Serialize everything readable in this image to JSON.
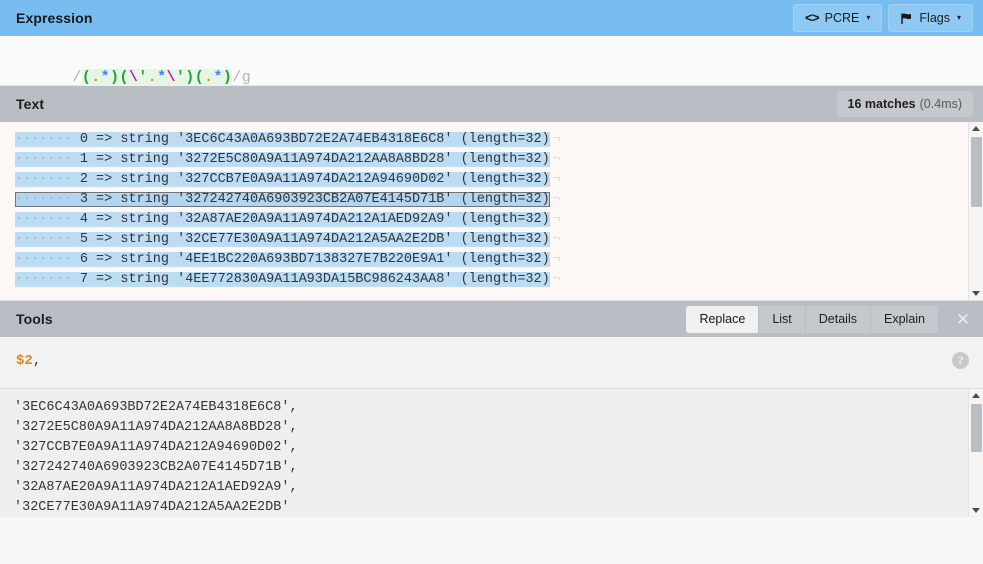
{
  "expression": {
    "panel_title": "Expression",
    "engine_button": {
      "label": "PCRE",
      "icon": "code-icon",
      "caret": "▾"
    },
    "flags_button": {
      "label": "Flags",
      "icon": "flag-icon",
      "caret": "▾"
    },
    "delimiter": "/",
    "flags": "g",
    "pattern": "(.*)(\\'.*\\')(.*)",
    "tokens": [
      {
        "t": "(",
        "k": "paren",
        "g": 1
      },
      {
        "t": ".",
        "k": "dot",
        "g": 1
      },
      {
        "t": "*",
        "k": "star",
        "g": 1
      },
      {
        "t": ")",
        "k": "paren",
        "g": 1
      },
      {
        "t": "(",
        "k": "paren",
        "g": 2
      },
      {
        "t": "\\",
        "k": "esc",
        "g": 2
      },
      {
        "t": "'",
        "k": "quote",
        "g": 2
      },
      {
        "t": ".",
        "k": "dot",
        "g": 2
      },
      {
        "t": "*",
        "k": "star",
        "g": 2
      },
      {
        "t": "\\",
        "k": "esc",
        "g": 2
      },
      {
        "t": "'",
        "k": "quote",
        "g": 2
      },
      {
        "t": ")",
        "k": "paren",
        "g": 2
      },
      {
        "t": "(",
        "k": "paren",
        "g": 3
      },
      {
        "t": ".",
        "k": "dot",
        "g": 3
      },
      {
        "t": "*",
        "k": "star",
        "g": 3
      },
      {
        "t": ")",
        "k": "paren",
        "g": 3
      }
    ]
  },
  "text": {
    "panel_title": "Text",
    "match_count_label": "16 matches",
    "match_time": "(0.4ms)",
    "indent": "·······",
    "eol_marker": "¬",
    "lines": [
      {
        "index": "0",
        "arrow": "=>",
        "type": "string",
        "value": "'3EC6C43A0A693BD72E2A74EB4318E6C8'",
        "length": "(length=32)",
        "selected": false
      },
      {
        "index": "1",
        "arrow": "=>",
        "type": "string",
        "value": "'3272E5C80A9A11A974DA212AA8A8BD28'",
        "length": "(length=32)",
        "selected": false
      },
      {
        "index": "2",
        "arrow": "=>",
        "type": "string",
        "value": "'327CCB7E0A9A11A974DA212A94690D02'",
        "length": "(length=32)",
        "selected": false
      },
      {
        "index": "3",
        "arrow": "=>",
        "type": "string",
        "value": "'327242740A6903923CB2A07E4145D71B'",
        "length": "(length=32)",
        "selected": true
      },
      {
        "index": "4",
        "arrow": "=>",
        "type": "string",
        "value": "'32A87AE20A9A11A974DA212A1AED92A9'",
        "length": "(length=32)",
        "selected": false
      },
      {
        "index": "5",
        "arrow": "=>",
        "type": "string",
        "value": "'32CE77E30A9A11A974DA212A5AA2E2DB'",
        "length": "(length=32)",
        "selected": false
      },
      {
        "index": "6",
        "arrow": "=>",
        "type": "string",
        "value": "'4EE1BC220A693BD7138327E7B220E9A1'",
        "length": "(length=32)",
        "selected": false
      },
      {
        "index": "7",
        "arrow": "=>",
        "type": "string",
        "value": "'4EE772830A9A11A93DA15BC986243AA8'",
        "length": "(length=32)",
        "selected": false
      }
    ]
  },
  "tools": {
    "panel_title": "Tools",
    "tabs": [
      {
        "label": "Replace",
        "active": true
      },
      {
        "label": "List",
        "active": false
      },
      {
        "label": "Details",
        "active": false
      },
      {
        "label": "Explain",
        "active": false
      }
    ],
    "close_label": "✕",
    "replace": {
      "reference": "$2",
      "suffix": ",",
      "help_label": "?"
    },
    "result_lines": [
      "'3EC6C43A0A693BD72E2A74EB4318E6C8',",
      "'3272E5C80A9A11A974DA212AA8A8BD28',",
      "'327CCB7E0A9A11A974DA212A94690D02',",
      "'327242740A6903923CB2A07E4145D71B',",
      "'32A87AE20A9A11A974DA212A1AED92A9',",
      "'32CE77E30A9A11A974DA212A5AA2E2DB'"
    ]
  },
  "colors": {
    "header_blue": "#78bdf0",
    "header_gray": "#b9bec4",
    "match_highlight": "#bcdcf4",
    "group_bg": "#e7f6e4",
    "token_paren": "#22a03c",
    "token_dot": "#e08a1e",
    "token_star": "#3f84ec",
    "token_escape": "#d011a8",
    "token_reference": "#e08a1e"
  }
}
